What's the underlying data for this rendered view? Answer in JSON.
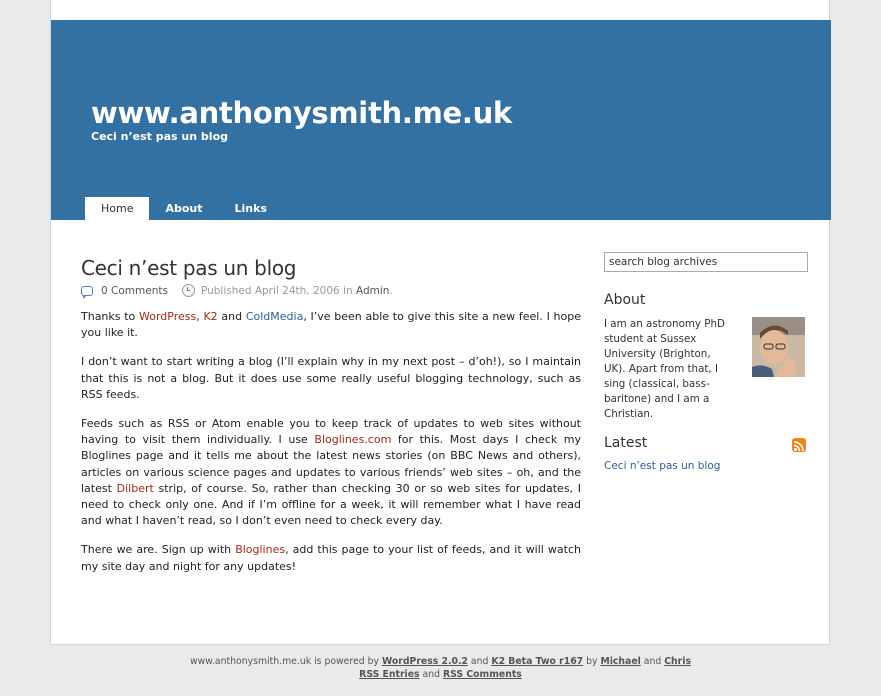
{
  "header": {
    "site_title": "www.anthonysmith.me.uk",
    "tagline": "Ceci n’est pas un blog",
    "bg_color": "#3371a3"
  },
  "nav": {
    "tabs": [
      {
        "label": "Home",
        "active": true
      },
      {
        "label": "About",
        "active": false
      },
      {
        "label": "Links",
        "active": false
      }
    ]
  },
  "post": {
    "title": "Ceci n’est pas un blog",
    "comments": "0 Comments",
    "published_prefix": "Published April 24th, 2006 in",
    "category": "Admin",
    "category_suffix": ".",
    "p1": {
      "t1": "Thanks to ",
      "link1": "WordPress",
      "t2": ", ",
      "link2": "K2",
      "t3": " and ",
      "link3": "ColdMedia",
      "t4": ", I’ve been able to give this site a new feel. I hope you like it."
    },
    "p2": "I don’t want to start writing a blog (I’ll explain why in my next post – d’oh!), so I maintain that this is not a blog. But it does use some really useful blogging technology, such as RSS feeds.",
    "p3": {
      "t1": "Feeds such as RSS or Atom enable you to keep track of updates to web sites without having to visit them individually. I use ",
      "link1": "Bloglines.com",
      "t2": " for this. Most days I check my Bloglines page and it tells me about the latest news stories (on BBC News and others), articles on various science pages and updates to various friends’ web sites – oh, and the latest ",
      "link2": "Dilbert",
      "t3": " strip, of course. So, rather than checking 30 or so web sites for updates, I need to check only one. And if I’m offline for a week, it will remember what I have read and what I haven’t read, so I don’t even need to check every day."
    },
    "p4": {
      "t1": "There we are. Sign up with ",
      "link1": "Bloglines",
      "t2": ", add this page to your list of feeds, and it will watch my site day and night for any updates!"
    }
  },
  "sidebar": {
    "search_value": "search blog archives",
    "about_heading": "About",
    "about_text": "I am an astronomy PhD student at Sussex University (Brighton, UK). Apart from that, I sing (classical, bass- baritone) and I am a Christian.",
    "latest_heading": "Latest",
    "latest_link": "Ceci n’est pas un blog"
  },
  "footer": {
    "t1": "www.anthonysmith.me.uk is powered by ",
    "link_wp": "WordPress 2.0.2",
    "t2": " and ",
    "link_k2": "K2 Beta Two r167",
    "t3": " by ",
    "link_michael": "Michael",
    "t4": " and ",
    "link_chris": "Chris",
    "link_rss_entries": "RSS Entries",
    "t5": " and ",
    "link_rss_comments": "RSS Comments"
  },
  "colors": {
    "link_red": "#a52a1a",
    "link_blue": "#2a5f9e",
    "page_bg": "#eaeaea"
  },
  "icons": [
    "comment-bubble-icon",
    "clock-icon",
    "rss-feed-icon"
  ]
}
